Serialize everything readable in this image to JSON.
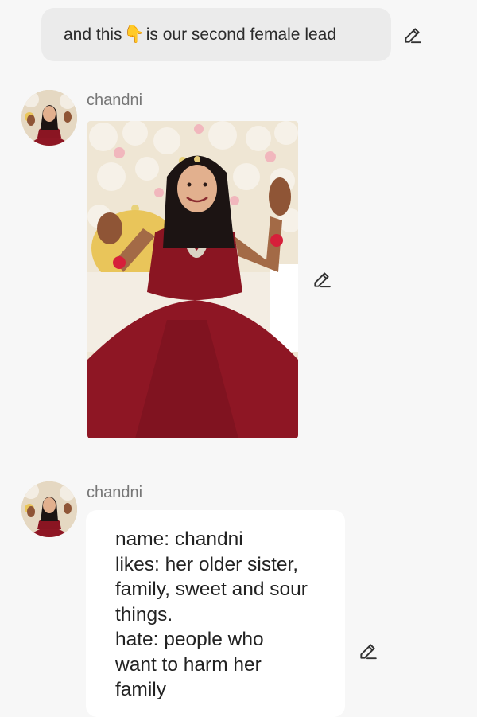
{
  "user_message": {
    "text_before": "and this",
    "emoji": "👇",
    "text_after": "is our second female lead"
  },
  "bot_messages": [
    {
      "sender": "chandni",
      "type": "image"
    },
    {
      "sender": "chandni",
      "type": "text",
      "lines": [
        "name: chandni",
        "likes: her older sister,",
        "family, sweet and sour",
        "things.",
        "hate: people who",
        "want to harm her",
        "family"
      ]
    }
  ],
  "icons": {
    "edit": "pencil-edit-icon"
  },
  "colors": {
    "background": "#f7f7f7",
    "user_bubble": "#ebebeb",
    "bot_bubble": "#ffffff",
    "dress": "#8e1624",
    "name_label": "#777777"
  }
}
